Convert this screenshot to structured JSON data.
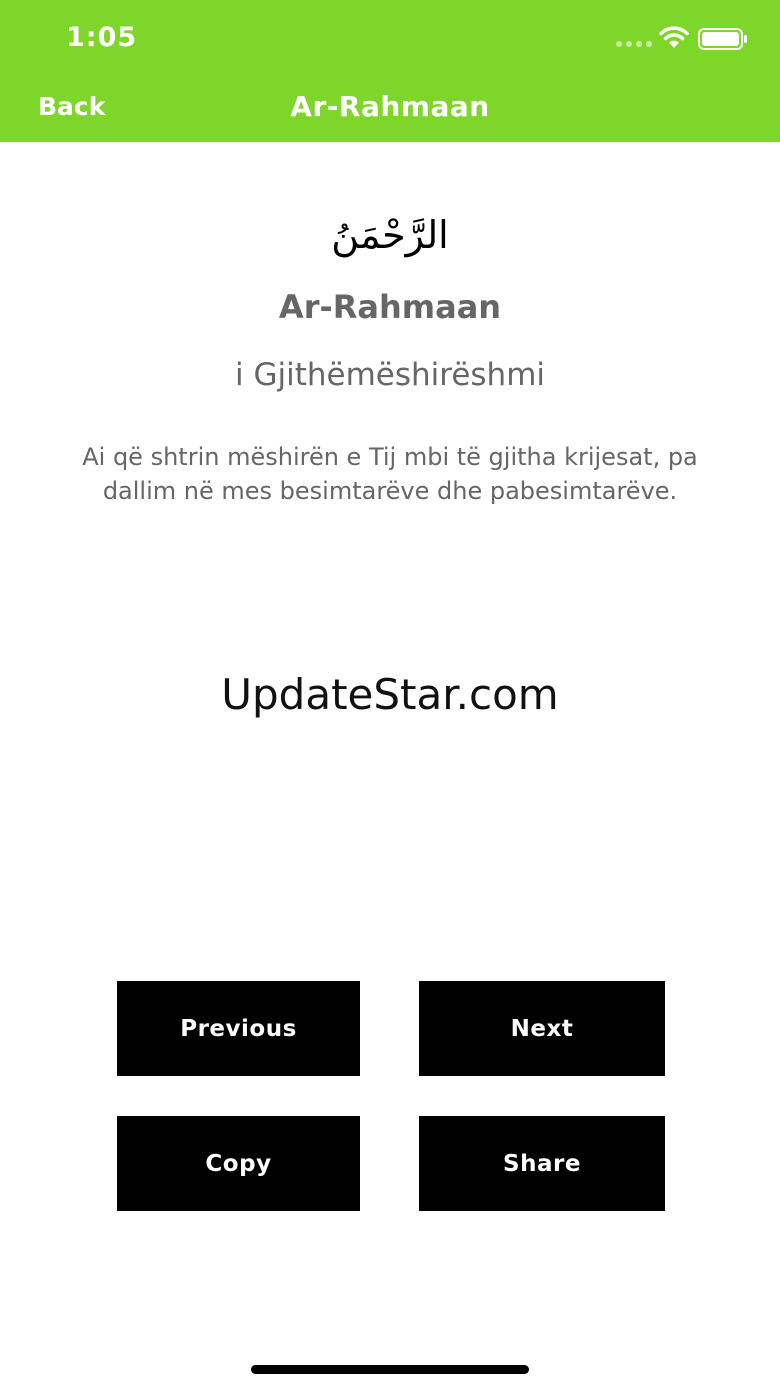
{
  "status_bar": {
    "time": "1:05",
    "signal_icon": "cellular-signal-icon",
    "wifi_icon": "wifi-icon",
    "battery_icon": "battery-icon",
    "color": "#7ed62b"
  },
  "nav_bar": {
    "back_label": "Back",
    "title": "Ar-Rahmaan",
    "color": "#7ed62b"
  },
  "content": {
    "arabic": "الرَّحْمَنُ",
    "transliteration": "Ar-Rahmaan",
    "translation": "i Gjithëmëshirëshmi",
    "description_line1": "Ai që shtrin mëshirën e Tij mbi të gjitha krijesat, pa",
    "description_line2": "dallim në mes besimtarëve dhe pabesimtarëve."
  },
  "watermark": "UpdateStar.com",
  "buttons": {
    "previous": "Previous",
    "next": "Next",
    "copy": "Copy",
    "share": "Share"
  }
}
